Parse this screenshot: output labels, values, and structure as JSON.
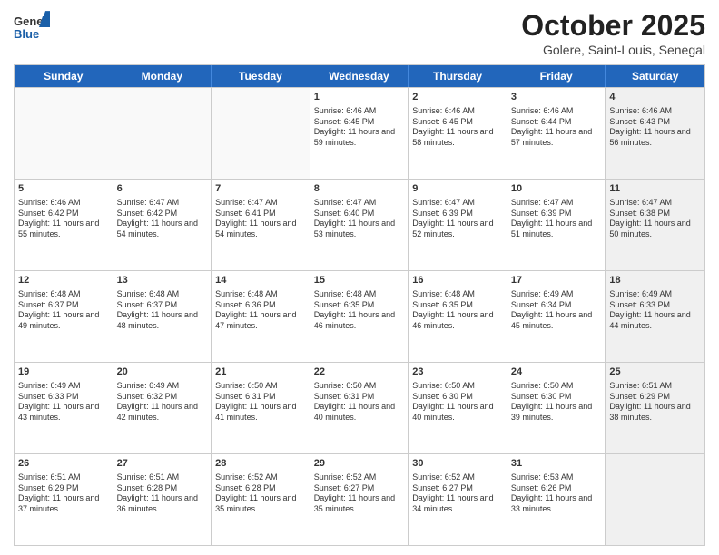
{
  "header": {
    "logo_general": "General",
    "logo_blue": "Blue",
    "month_year": "October 2025",
    "location": "Golere, Saint-Louis, Senegal"
  },
  "days_of_week": [
    "Sunday",
    "Monday",
    "Tuesday",
    "Wednesday",
    "Thursday",
    "Friday",
    "Saturday"
  ],
  "weeks": [
    [
      {
        "day": "",
        "sunrise": "",
        "sunset": "",
        "daylight": "",
        "shaded": false
      },
      {
        "day": "",
        "sunrise": "",
        "sunset": "",
        "daylight": "",
        "shaded": false
      },
      {
        "day": "",
        "sunrise": "",
        "sunset": "",
        "daylight": "",
        "shaded": false
      },
      {
        "day": "1",
        "sunrise": "Sunrise: 6:46 AM",
        "sunset": "Sunset: 6:45 PM",
        "daylight": "Daylight: 11 hours and 59 minutes.",
        "shaded": false
      },
      {
        "day": "2",
        "sunrise": "Sunrise: 6:46 AM",
        "sunset": "Sunset: 6:45 PM",
        "daylight": "Daylight: 11 hours and 58 minutes.",
        "shaded": false
      },
      {
        "day": "3",
        "sunrise": "Sunrise: 6:46 AM",
        "sunset": "Sunset: 6:44 PM",
        "daylight": "Daylight: 11 hours and 57 minutes.",
        "shaded": false
      },
      {
        "day": "4",
        "sunrise": "Sunrise: 6:46 AM",
        "sunset": "Sunset: 6:43 PM",
        "daylight": "Daylight: 11 hours and 56 minutes.",
        "shaded": true
      }
    ],
    [
      {
        "day": "5",
        "sunrise": "Sunrise: 6:46 AM",
        "sunset": "Sunset: 6:42 PM",
        "daylight": "Daylight: 11 hours and 55 minutes.",
        "shaded": false
      },
      {
        "day": "6",
        "sunrise": "Sunrise: 6:47 AM",
        "sunset": "Sunset: 6:42 PM",
        "daylight": "Daylight: 11 hours and 54 minutes.",
        "shaded": false
      },
      {
        "day": "7",
        "sunrise": "Sunrise: 6:47 AM",
        "sunset": "Sunset: 6:41 PM",
        "daylight": "Daylight: 11 hours and 54 minutes.",
        "shaded": false
      },
      {
        "day": "8",
        "sunrise": "Sunrise: 6:47 AM",
        "sunset": "Sunset: 6:40 PM",
        "daylight": "Daylight: 11 hours and 53 minutes.",
        "shaded": false
      },
      {
        "day": "9",
        "sunrise": "Sunrise: 6:47 AM",
        "sunset": "Sunset: 6:39 PM",
        "daylight": "Daylight: 11 hours and 52 minutes.",
        "shaded": false
      },
      {
        "day": "10",
        "sunrise": "Sunrise: 6:47 AM",
        "sunset": "Sunset: 6:39 PM",
        "daylight": "Daylight: 11 hours and 51 minutes.",
        "shaded": false
      },
      {
        "day": "11",
        "sunrise": "Sunrise: 6:47 AM",
        "sunset": "Sunset: 6:38 PM",
        "daylight": "Daylight: 11 hours and 50 minutes.",
        "shaded": true
      }
    ],
    [
      {
        "day": "12",
        "sunrise": "Sunrise: 6:48 AM",
        "sunset": "Sunset: 6:37 PM",
        "daylight": "Daylight: 11 hours and 49 minutes.",
        "shaded": false
      },
      {
        "day": "13",
        "sunrise": "Sunrise: 6:48 AM",
        "sunset": "Sunset: 6:37 PM",
        "daylight": "Daylight: 11 hours and 48 minutes.",
        "shaded": false
      },
      {
        "day": "14",
        "sunrise": "Sunrise: 6:48 AM",
        "sunset": "Sunset: 6:36 PM",
        "daylight": "Daylight: 11 hours and 47 minutes.",
        "shaded": false
      },
      {
        "day": "15",
        "sunrise": "Sunrise: 6:48 AM",
        "sunset": "Sunset: 6:35 PM",
        "daylight": "Daylight: 11 hours and 46 minutes.",
        "shaded": false
      },
      {
        "day": "16",
        "sunrise": "Sunrise: 6:48 AM",
        "sunset": "Sunset: 6:35 PM",
        "daylight": "Daylight: 11 hours and 46 minutes.",
        "shaded": false
      },
      {
        "day": "17",
        "sunrise": "Sunrise: 6:49 AM",
        "sunset": "Sunset: 6:34 PM",
        "daylight": "Daylight: 11 hours and 45 minutes.",
        "shaded": false
      },
      {
        "day": "18",
        "sunrise": "Sunrise: 6:49 AM",
        "sunset": "Sunset: 6:33 PM",
        "daylight": "Daylight: 11 hours and 44 minutes.",
        "shaded": true
      }
    ],
    [
      {
        "day": "19",
        "sunrise": "Sunrise: 6:49 AM",
        "sunset": "Sunset: 6:33 PM",
        "daylight": "Daylight: 11 hours and 43 minutes.",
        "shaded": false
      },
      {
        "day": "20",
        "sunrise": "Sunrise: 6:49 AM",
        "sunset": "Sunset: 6:32 PM",
        "daylight": "Daylight: 11 hours and 42 minutes.",
        "shaded": false
      },
      {
        "day": "21",
        "sunrise": "Sunrise: 6:50 AM",
        "sunset": "Sunset: 6:31 PM",
        "daylight": "Daylight: 11 hours and 41 minutes.",
        "shaded": false
      },
      {
        "day": "22",
        "sunrise": "Sunrise: 6:50 AM",
        "sunset": "Sunset: 6:31 PM",
        "daylight": "Daylight: 11 hours and 40 minutes.",
        "shaded": false
      },
      {
        "day": "23",
        "sunrise": "Sunrise: 6:50 AM",
        "sunset": "Sunset: 6:30 PM",
        "daylight": "Daylight: 11 hours and 40 minutes.",
        "shaded": false
      },
      {
        "day": "24",
        "sunrise": "Sunrise: 6:50 AM",
        "sunset": "Sunset: 6:30 PM",
        "daylight": "Daylight: 11 hours and 39 minutes.",
        "shaded": false
      },
      {
        "day": "25",
        "sunrise": "Sunrise: 6:51 AM",
        "sunset": "Sunset: 6:29 PM",
        "daylight": "Daylight: 11 hours and 38 minutes.",
        "shaded": true
      }
    ],
    [
      {
        "day": "26",
        "sunrise": "Sunrise: 6:51 AM",
        "sunset": "Sunset: 6:29 PM",
        "daylight": "Daylight: 11 hours and 37 minutes.",
        "shaded": false
      },
      {
        "day": "27",
        "sunrise": "Sunrise: 6:51 AM",
        "sunset": "Sunset: 6:28 PM",
        "daylight": "Daylight: 11 hours and 36 minutes.",
        "shaded": false
      },
      {
        "day": "28",
        "sunrise": "Sunrise: 6:52 AM",
        "sunset": "Sunset: 6:28 PM",
        "daylight": "Daylight: 11 hours and 35 minutes.",
        "shaded": false
      },
      {
        "day": "29",
        "sunrise": "Sunrise: 6:52 AM",
        "sunset": "Sunset: 6:27 PM",
        "daylight": "Daylight: 11 hours and 35 minutes.",
        "shaded": false
      },
      {
        "day": "30",
        "sunrise": "Sunrise: 6:52 AM",
        "sunset": "Sunset: 6:27 PM",
        "daylight": "Daylight: 11 hours and 34 minutes.",
        "shaded": false
      },
      {
        "day": "31",
        "sunrise": "Sunrise: 6:53 AM",
        "sunset": "Sunset: 6:26 PM",
        "daylight": "Daylight: 11 hours and 33 minutes.",
        "shaded": false
      },
      {
        "day": "",
        "sunrise": "",
        "sunset": "",
        "daylight": "",
        "shaded": true
      }
    ]
  ]
}
